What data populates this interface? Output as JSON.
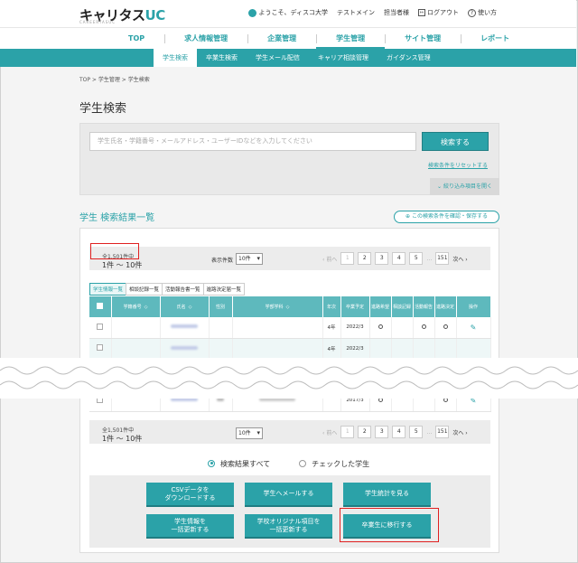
{
  "header": {
    "logo_main": "キャリタス",
    "logo_uc": "UC",
    "logo_sub": "CAREERTASUC",
    "welcome": "ようこそ、ディスコ大学",
    "user": "テストメイン",
    "role": "担当者様",
    "logout": "ログアウト",
    "help": "使い方"
  },
  "nav": {
    "items": [
      "TOP",
      "求人情報管理",
      "企業管理",
      "学生管理",
      "サイト管理",
      "レポート"
    ],
    "active_index": 3
  },
  "subnav": {
    "items": [
      "学生検索",
      "卒業生検索",
      "学生メール配信",
      "キャリア相談管理",
      "ガイダンス管理"
    ],
    "active_index": 0
  },
  "breadcrumb": "TOP > 学生管理 > 学生検索",
  "page_title": "学生検索",
  "search": {
    "placeholder": "学生氏名・学籍番号・メールアドレス・ユーザーIDなどを入力してください",
    "button": "検索する",
    "reset": "検索条件をリセットする",
    "expand": "絞り込み項目を開く"
  },
  "results": {
    "title": "学生 検索結果一覧",
    "confirm_save": "この検索条件を確認・保存する",
    "total": "全1,501件中",
    "range": "1件 ～ 10件",
    "page_size_label": "表示件数",
    "page_size": "10件",
    "prev": "前へ",
    "next": "次へ",
    "pages": [
      "1",
      "2",
      "3",
      "4",
      "5",
      "151"
    ],
    "ellipsis": "…",
    "tabs": [
      "学生情報一覧",
      "相談記録一覧",
      "活動報告書一覧",
      "進路決定届一覧"
    ],
    "columns": [
      "学籍番号",
      "氏名",
      "性別",
      "学部学科",
      "年次",
      "卒業予定",
      "進路希望",
      "相談記録",
      "活動報告",
      "進路決定",
      "操作"
    ],
    "rows": [
      {
        "grade": "4年",
        "grad": "2022/3"
      },
      {
        "grade": "4年",
        "grad": "2022/3"
      },
      {
        "grade": "",
        "grad": "2017/3"
      }
    ]
  },
  "radio": {
    "all": "検索結果すべて",
    "checked": "チェックした学生"
  },
  "actions": {
    "csv": "CSVデータを\nダウンロードする",
    "mail": "学生へメールする",
    "stats": "学生統計を見る",
    "bulk_update": "学生情報を\n一括更新する",
    "school_update": "学校オリジナル項目を\n一括更新する",
    "graduate": "卒業生に移行する"
  }
}
